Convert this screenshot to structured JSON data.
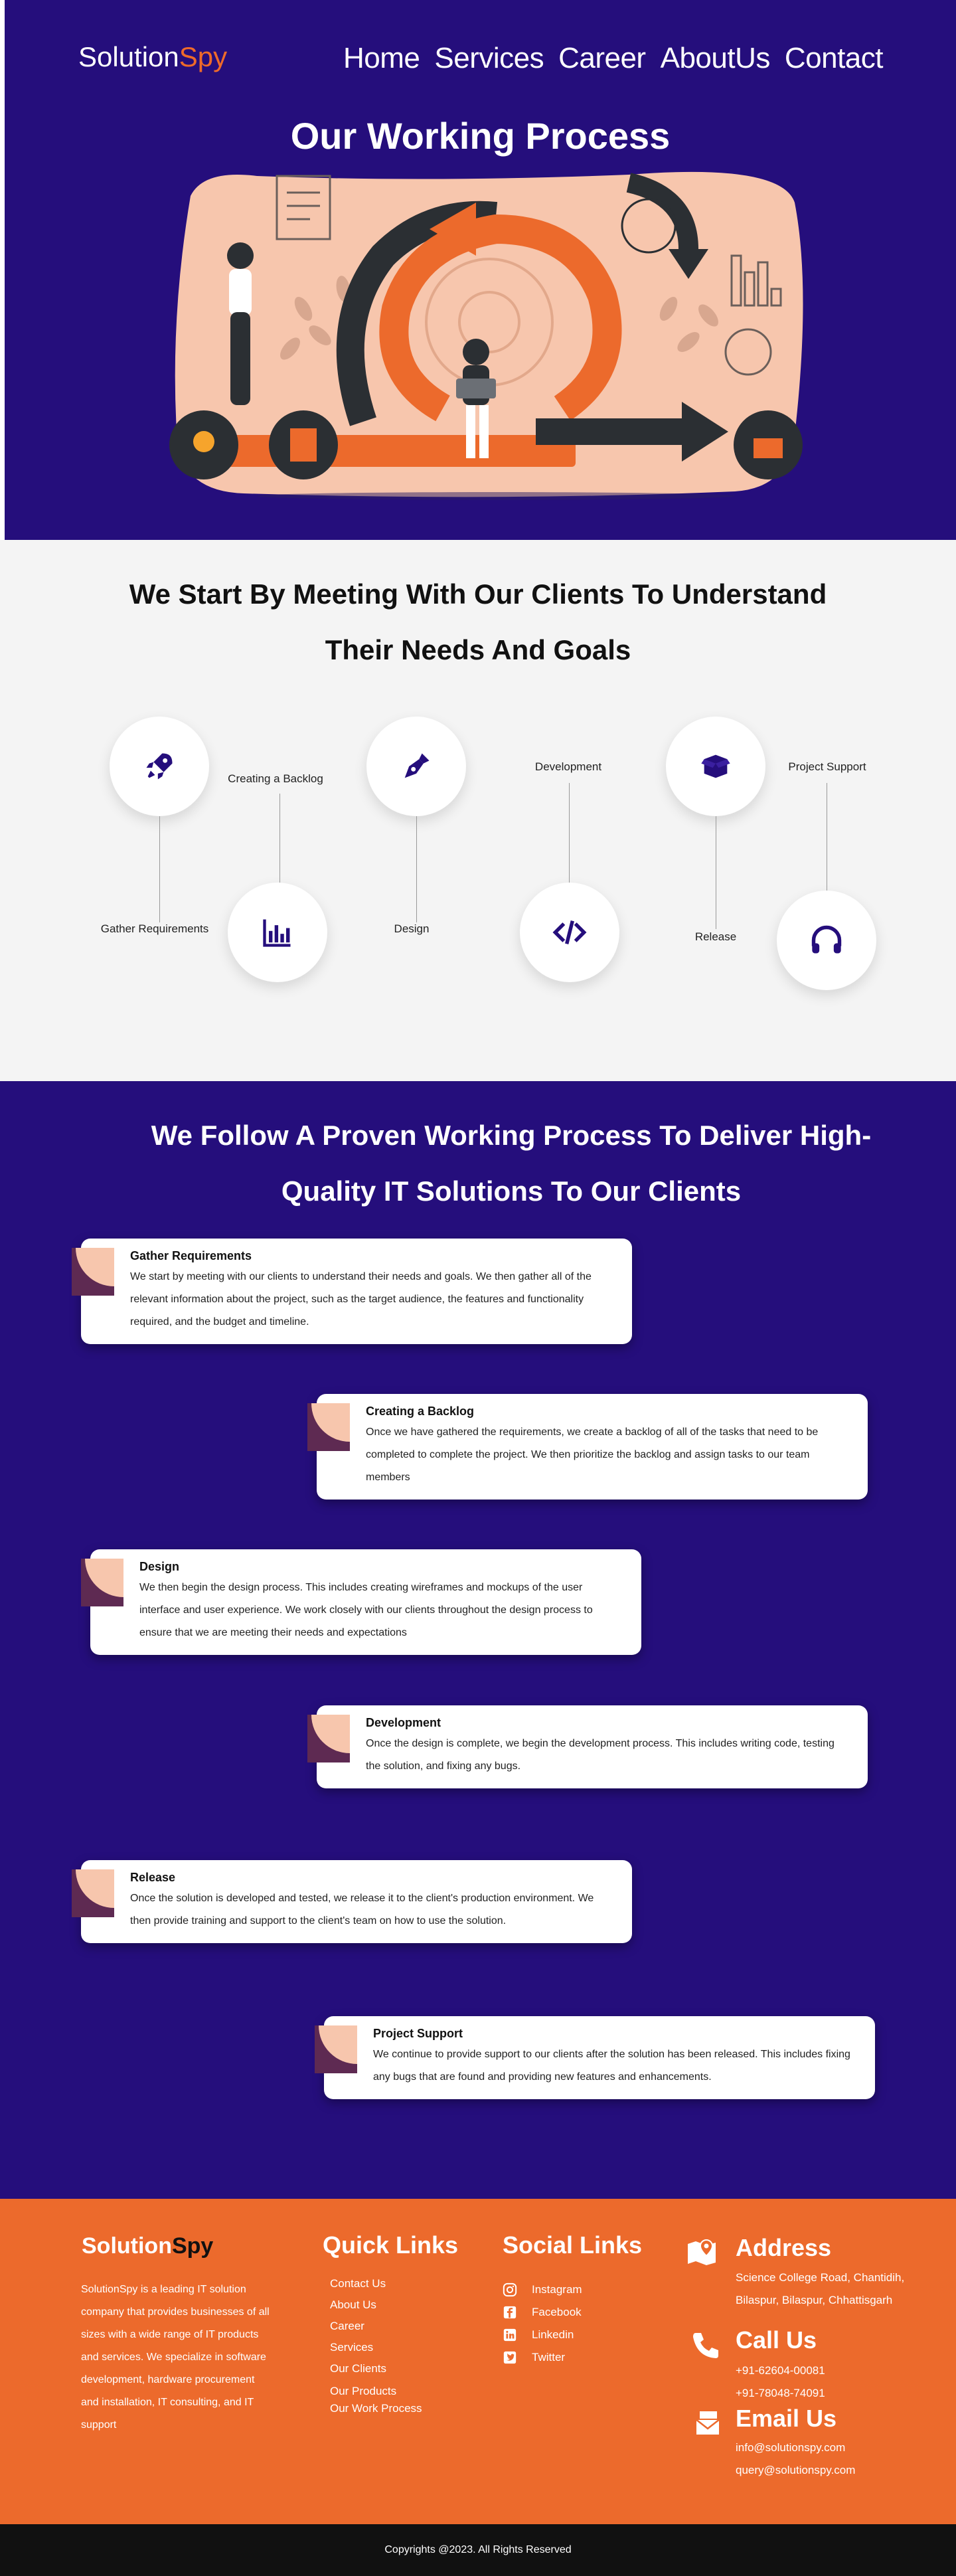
{
  "header": {
    "logo_main": "Solution",
    "logo_accent": "Spy",
    "nav": [
      "Home",
      "Services",
      "Career",
      "AboutUs",
      "Contact"
    ]
  },
  "hero": {
    "title": "Our Working Process"
  },
  "overview": {
    "heading": "We Start By Meeting With Our Clients To Understand Their Needs And Goals",
    "steps": [
      {
        "label": "Gather Requirements",
        "icon": "rocket-icon"
      },
      {
        "label": "Creating a Backlog",
        "icon": "bar-chart-icon"
      },
      {
        "label": "Design",
        "icon": "pen-nib-icon"
      },
      {
        "label": "Development",
        "icon": "code-icon"
      },
      {
        "label": "Release",
        "icon": "box-open-icon"
      },
      {
        "label": "Project Support",
        "icon": "headphones-icon"
      }
    ]
  },
  "process": {
    "heading": "We Follow A Proven Working Process To Deliver High-Quality IT Solutions To Our Clients",
    "cards": [
      {
        "title": "Gather Requirements",
        "desc": "We start by meeting with our clients to understand their needs and goals. We then gather all of the relevant information about the project, such as the target audience, the features and functionality required, and the budget and timeline."
      },
      {
        "title": "Creating a Backlog",
        "desc": "Once we have gathered the requirements, we create a backlog of all of the tasks that need to be completed to complete the project. We then prioritize the backlog and assign tasks to our team members"
      },
      {
        "title": "Design",
        "desc": "We then begin the design process. This includes creating wireframes and mockups of the user interface and user experience. We work closely with our clients throughout the design process to ensure that we are meeting their needs and expectations"
      },
      {
        "title": "Development",
        "desc": "Once the design is complete, we begin the development process. This includes writing code, testing the solution, and fixing any bugs."
      },
      {
        "title": "Release",
        "desc": "Once the solution is developed and tested, we release it to the client's production environment. We then provide training and support to the client's team on how to use the solution."
      },
      {
        "title": "Project Support",
        "desc": "We continue to provide support to our clients after the solution has been released. This includes fixing any bugs that are found and providing new features and enhancements."
      }
    ]
  },
  "footer": {
    "logo_main": "Solution",
    "logo_accent": "Spy",
    "about": "SolutionSpy is a leading IT solution company that provides businesses of all sizes with a wide range of IT products and services. We specialize in software development, hardware procurement and installation, IT consulting, and IT support",
    "quick_links_title": "Quick Links",
    "quick_links": [
      "Contact Us",
      "About Us",
      "Career",
      "Services",
      "Our Clients",
      "Our Products",
      "Our Work Process"
    ],
    "social_title": "Social Links",
    "social": [
      {
        "label": "Instagram",
        "icon": "instagram-icon"
      },
      {
        "label": "Facebook",
        "icon": "facebook-icon"
      },
      {
        "label": "Linkedin",
        "icon": "linkedin-icon"
      },
      {
        "label": "Twitter",
        "icon": "twitter-icon"
      }
    ],
    "address_title": "Address",
    "address_line1": "Science College Road, Chantidih,",
    "address_line2": "Bilaspur, Bilaspur, Chhattisgarh",
    "call_title": "Call Us",
    "phone1": "+91-62604-00081",
    "phone2": "+91-78048-74091",
    "email_title": "Email Us",
    "email1": "info@solutionspy.com",
    "email2": "query@solutionspy.com"
  },
  "copyright": "Copyrights @2023. All Rights Reserved",
  "colors": {
    "primary": "#250e7c",
    "accent": "#ec6a2c",
    "peach": "#f7c6ad"
  }
}
